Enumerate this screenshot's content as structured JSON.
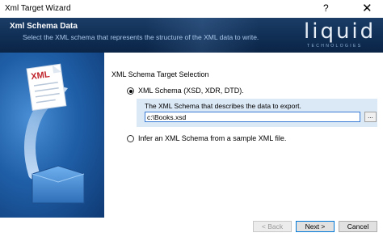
{
  "window": {
    "title": "Xml Target Wizard",
    "help_glyph": "?",
    "close_glyph": "✕"
  },
  "banner": {
    "title": "Xml Schema Data",
    "subtitle": "Select the XML schema that represents the structure of the XML data to write.",
    "logo_main": "liquid",
    "logo_sub": "TECHNOLOGIES"
  },
  "side_art": {
    "badge_text": "XML",
    "icon": "xml-document-into-folder-icon"
  },
  "form": {
    "section_title": "XML Schema Target Selection",
    "options": [
      {
        "label": "XML Schema (XSD, XDR, DTD).",
        "selected": true
      },
      {
        "label": "Infer an XML Schema from a sample XML file.",
        "selected": false
      }
    ],
    "schema_group": {
      "description": "The XML Schema that describes the data to export.",
      "path_value": "c:\\Books.xsd",
      "browse_label": "..."
    }
  },
  "footer": {
    "back_label": "< Back",
    "next_label": "Next >",
    "cancel_label": "Cancel"
  },
  "colors": {
    "banner": "#123158",
    "group_bg": "#dbe8f5",
    "accent": "#0078d7"
  }
}
